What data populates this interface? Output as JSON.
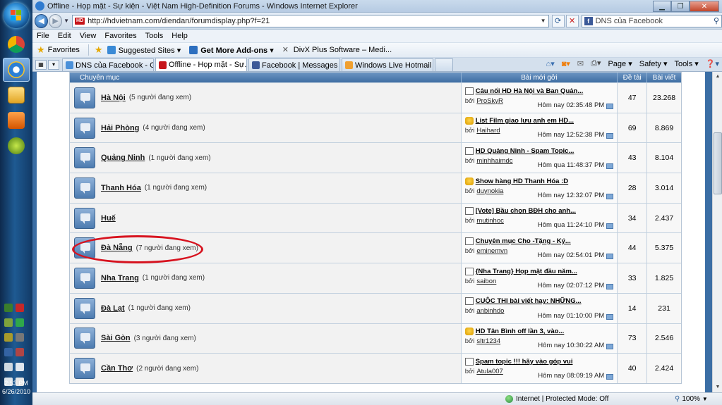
{
  "taskbar": {
    "clock_time": "2:53 PM",
    "clock_date": "6/26/2010"
  },
  "browser": {
    "title": "Offline - Họp mặt - Sự kiện - Việt Nam High-Definition Forums - Windows Internet Explorer",
    "address": "http://hdvietnam.com/diendan/forumdisplay.php?f=21",
    "search_text": "DNS của Facebook",
    "menu": [
      "File",
      "Edit",
      "View",
      "Favorites",
      "Tools",
      "Help"
    ],
    "favorites_label": "Favorites",
    "fav_items": [
      "Suggested Sites ▾",
      "Get More Add-ons ▾",
      "DivX Plus Software – Medi..."
    ],
    "tabs": [
      {
        "label": "DNS của Facebook - Goog...",
        "color": "#4a90d9"
      },
      {
        "label": "Offline - Họp mặt - Sự...",
        "color": "#c7161b"
      },
      {
        "label": "Facebook | Messages",
        "color": "#3b5998"
      },
      {
        "label": "Windows Live Hotmail",
        "color": "#f0a030"
      }
    ],
    "commands": [
      "Page ▾",
      "Safety ▾",
      "Tools ▾"
    ],
    "status_zone": "Internet | Protected Mode: Off",
    "zoom": "100%"
  },
  "table": {
    "headers": {
      "category": "Chuyên mục",
      "last_post": "Bài mới gởi",
      "threads": "Đề tài",
      "posts": "Bài viết"
    },
    "by_label": "bởi",
    "rows": [
      {
        "name": "Hà Nội",
        "viewers": "(5 người đang xem)",
        "post_title": "Câu nối HD Hà Nội và Ban Quản...",
        "post_icon": "doc",
        "user": "ProSkyR",
        "date": "Hôm nay 02:35:48 PM",
        "threads": "47",
        "posts": "23.268"
      },
      {
        "name": "Hải Phòng",
        "viewers": "(4 người đang xem)",
        "post_title": "List Film giao lưu anh em HD...",
        "post_icon": "thumb",
        "user": "Haihard",
        "date": "Hôm nay 12:52:38 PM",
        "threads": "69",
        "posts": "8.869"
      },
      {
        "name": "Quảng Ninh",
        "viewers": "(1 người đang xem)",
        "post_title": "HD Quảng Ninh - Spam Topic...",
        "post_icon": "doc",
        "user": "minhhaimdc",
        "date": "Hôm qua 11:48:37 PM",
        "threads": "43",
        "posts": "8.104"
      },
      {
        "name": "Thanh Hóa",
        "viewers": "(1 người đang xem)",
        "post_title": "Show hàng HD Thanh Hóa :D",
        "post_icon": "thumb",
        "user": "duynokia",
        "date": "Hôm nay 12:32:07 PM",
        "threads": "28",
        "posts": "3.014"
      },
      {
        "name": "Huế",
        "viewers": "",
        "post_title": "[Vote] Bầu chọn BĐH cho anh...",
        "post_icon": "doc",
        "user": "mutinhoc",
        "date": "Hôm qua 11:24:10 PM",
        "threads": "34",
        "posts": "2.437"
      },
      {
        "name": "Đà Nẵng",
        "viewers": "(7 người đang xem)",
        "post_title": "Chuyên mục Cho -Tặng - Ký...",
        "post_icon": "doc",
        "user": "eminemvn",
        "date": "Hôm nay 02:54:01 PM",
        "threads": "44",
        "posts": "5.375"
      },
      {
        "name": "Nha Trang",
        "viewers": "(1 người đang xem)",
        "post_title": "{Nha Trang} Họp mặt đầu năm...",
        "post_icon": "doc",
        "user": "saibon",
        "date": "Hôm nay 02:07:12 PM",
        "threads": "33",
        "posts": "1.825"
      },
      {
        "name": "Đà Lạt",
        "viewers": "(1 người đang xem)",
        "post_title": "CUỘC THI bài viết hay: NHỮNG...",
        "post_icon": "doc",
        "user": "anbinhdo",
        "date": "Hôm nay 01:10:00 PM",
        "threads": "14",
        "posts": "231"
      },
      {
        "name": "Sài Gòn",
        "viewers": "(3 người đang xem)",
        "post_title": "HD Tân Bình off lần 3, vào...",
        "post_icon": "thumb",
        "user": "sltr1234",
        "date": "Hôm nay 10:30:22 AM",
        "threads": "73",
        "posts": "2.546"
      },
      {
        "name": "Cần Thơ",
        "viewers": "(2 người đang xem)",
        "post_title": "Spam topic !!! hãy vào góp vui",
        "post_icon": "doc",
        "user": "Atula007",
        "date": "Hôm nay 08:09:19 AM",
        "threads": "40",
        "posts": "2.424"
      }
    ]
  }
}
